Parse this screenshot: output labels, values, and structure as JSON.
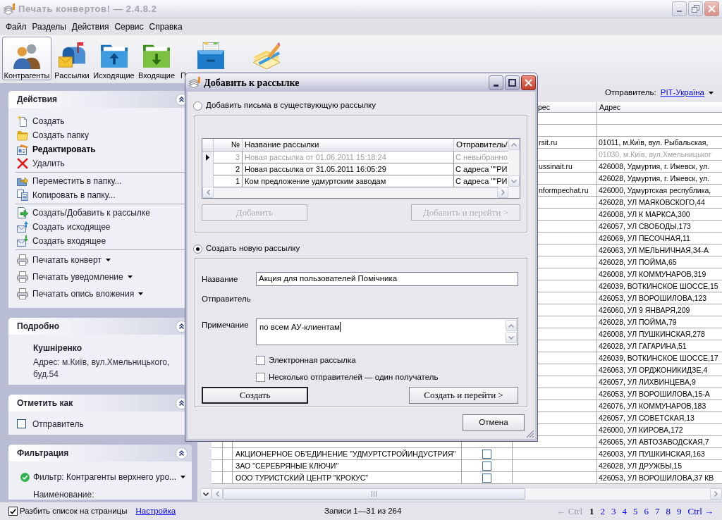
{
  "window": {
    "title": "Печать конвертов! — 2.4.8.2"
  },
  "menu": [
    "Файл",
    "Разделы",
    "Действия",
    "Сервис",
    "Справка"
  ],
  "toolbar": [
    {
      "label": "Контрагенты",
      "selected": true
    },
    {
      "label": "Рассылки",
      "selected": false
    },
    {
      "label": "Исходящие",
      "selected": false
    },
    {
      "label": "Входящие",
      "selected": false
    },
    {
      "label": "П",
      "selected": false
    },
    {
      "selected": false
    }
  ],
  "sidebar": {
    "actions": {
      "title": "Действия",
      "expanded": true,
      "groups": [
        [
          {
            "label": "Создать",
            "default": false,
            "dropdown": false
          },
          {
            "label": "Создать папку",
            "default": false,
            "dropdown": false
          },
          {
            "label": "Редактировать",
            "default": true,
            "dropdown": false
          },
          {
            "label": "Удалить",
            "default": false,
            "dropdown": false
          }
        ],
        [
          {
            "label": "Переместить в папку...",
            "default": false,
            "dropdown": false
          },
          {
            "label": "Копировать в папку...",
            "default": false,
            "dropdown": false
          }
        ],
        [
          {
            "label": "Создать/Добавить к рассылке",
            "default": false,
            "dropdown": false
          },
          {
            "label": "Создать исходящее",
            "default": false,
            "dropdown": false
          },
          {
            "label": "Создать входящее",
            "default": false,
            "dropdown": false
          }
        ],
        [
          {
            "label": "Печатать конверт",
            "default": false,
            "dropdown": true
          },
          {
            "label": "Печатать уведомление",
            "default": false,
            "dropdown": true
          },
          {
            "label": "Печатать опись вложения",
            "default": false,
            "dropdown": true
          }
        ]
      ]
    },
    "details": {
      "title": "Подробно",
      "expanded": true,
      "name": "Кушніренко",
      "address": "Адрес: м.Київ, вул.Хмельницького, буд.54"
    },
    "mark_as": {
      "title": "Отметить как",
      "expanded": true,
      "options": [
        {
          "label": "Отправитель",
          "checked": false
        }
      ]
    },
    "filtering": {
      "title": "Фильтрация",
      "expanded": true,
      "filter": "Фильтр: Контрагенты верхнего уро...",
      "field_label": "Наименование:"
    }
  },
  "list_header": {
    "sender_label": "Отправитель:",
    "sender": "РІТ-Україна"
  },
  "table": {
    "columns": [
      "рес",
      "Адрес"
    ],
    "rows": [
      {},
      {},
      {
        "email": "rsit.ru",
        "address": "01011, м.Київ, вул. Рыбальская,",
        "grayed": false
      },
      {
        "address": "01030, м.Київ, вул.Хмельницьког",
        "grayed": true
      },
      {
        "email": "ussinait.ru",
        "address": "426008, Удмуртия, г. Ижевск, ул.",
        "grayed": false
      },
      {
        "address": "426028, Удмуртия, г. Ижевск, ул.",
        "grayed": false
      },
      {
        "email": "nformpechat.ru",
        "address": "426000, Удмуртская республика,",
        "grayed": false
      },
      {
        "address": "426028, УЛ МАЯКОВСКОГО,44",
        "grayed": false
      },
      {
        "address": "426008, УЛ К МАРКСА,300",
        "grayed": false
      },
      {
        "address": "426057, УЛ СВОБОДЫ,173",
        "grayed": false
      },
      {
        "address": "426069, УЛ ПЕСОЧНАЯ,11",
        "grayed": false
      },
      {
        "address": "426063, УЛ МЕЛЬНИЧНАЯ,34-А",
        "grayed": false
      },
      {
        "address": "426028, УЛ ПОЙМА,65",
        "grayed": false
      },
      {
        "address": "426008, УЛ КОММУНАРОВ,319",
        "grayed": false
      },
      {
        "address": "426039, ВОТКИНСКОЕ ШОССЕ,15",
        "grayed": false
      },
      {
        "address": "426053, УЛ ВОРОШИЛОВА,123",
        "grayed": false
      },
      {
        "address": "426060, УЛ 9 ЯНВАРЯ,209",
        "grayed": false
      },
      {
        "address": "426028, УЛ ПОЙМА,79",
        "grayed": false
      },
      {
        "address": "426008, УЛ ПУШКИНСКАЯ,278",
        "grayed": false
      },
      {
        "address": "426028, УЛ ГАГАРИНА,51",
        "grayed": false
      },
      {
        "address": "426039, ВОТКИНСКОЕ ШОССЕ,17",
        "grayed": false
      },
      {
        "address": "426063, УЛ ОРДЖОНИКИДЗЕ,4",
        "grayed": false
      },
      {
        "address": "426057, УЛ ЛИХВИНЦЕВА,9",
        "grayed": false
      },
      {
        "address": "426053, УЛ ВОРОШИЛОВА,15-А",
        "grayed": false
      },
      {
        "address": "426076, УЛ КОММУНАРОВ,183",
        "grayed": false
      },
      {
        "address": "426057, УЛ СОВЕТСКАЯ,13",
        "grayed": false
      },
      {
        "address": "426000, УЛ КИРОВА,172",
        "grayed": false
      },
      {
        "address": "426065, УЛ АВТОЗАВОДСКАЯ,7",
        "grayed": false
      },
      {
        "name": "АКЦИОНЕРНОЕ ОБ'ЕДИНЕНИЕ \"УДМУРТСТРОЙИНДУСТРИЯ\"",
        "checked": false,
        "address": "426003, УЛ ПУШКИНСКАЯ,163",
        "grayed": false
      },
      {
        "name": "ЗАО \"СЕРЕБРЯНЫЕ КЛЮЧИ\"",
        "checked": false,
        "address": "426028, УЛ ДРУЖБЫ,15",
        "grayed": false
      },
      {
        "name": "ООО ТУРИСТСКИЙ ЦЕНТР \"КРОКУС\"",
        "checked": false,
        "address": "426053, УЛ ВОРОШИЛОВА,37 КВ",
        "grayed": false
      }
    ]
  },
  "dialog": {
    "title": "Добавить к рассылке",
    "existing": {
      "label": "Добавить письма в существующую рассылку",
      "selected": false,
      "columns": [
        "№",
        "Название рассылки",
        "Отправитель/"
      ],
      "rows": [
        {
          "number": "3",
          "name": "Новая рассылка от 01.06.2011 15:18:24",
          "sender": "С невыбранно",
          "selected": true,
          "grayed": true
        },
        {
          "number": "2",
          "name": "Новая рассылка от 31.05.2011 16:05:29",
          "sender": "С адреса \"\"РИ",
          "selected": false,
          "grayed": false
        },
        {
          "number": "1",
          "name": "Ком предложение удмуртским заводам",
          "sender": "С адреса \"\"РИ",
          "selected": false,
          "grayed": false
        }
      ],
      "buttons": [
        {
          "label": "Добавить",
          "disabled": true
        },
        {
          "label": "Добавить и перейти >",
          "disabled": true
        }
      ]
    },
    "create": {
      "label": "Создать новую рассылку",
      "selected": true,
      "name_field": {
        "label": "Название",
        "value": "Акция для пользователей Помічника"
      },
      "sender_label": "Отправитель",
      "note_field": {
        "label": "Примечание",
        "value": "по всем АУ-клиентам",
        "focused": true
      },
      "options": [
        {
          "label": "Электронная рассылка",
          "checked": false
        },
        {
          "label": "Несколько отправителей — один получатель",
          "checked": false
        }
      ],
      "buttons": [
        {
          "label": "Создать",
          "default": true
        },
        {
          "label": "Создать и перейти >",
          "default": false
        }
      ]
    },
    "cancel": "Отмена"
  },
  "status_bar": {
    "paginate": {
      "label": "Разбить список на страницы",
      "checked": true
    },
    "settings_link": "Настройка",
    "records": "Записи 1—31 из 264",
    "pager": {
      "prev": {
        "label": "← Ctrl",
        "disabled": true
      },
      "pages": [
        {
          "label": "1",
          "selected": true
        },
        {
          "label": "2",
          "selected": false
        },
        {
          "label": "3",
          "selected": false
        },
        {
          "label": "4",
          "selected": false
        },
        {
          "label": "5",
          "selected": false
        },
        {
          "label": "6",
          "selected": false
        },
        {
          "label": "7",
          "selected": false
        },
        {
          "label": "8",
          "selected": false
        },
        {
          "label": "9",
          "selected": false
        }
      ],
      "next": {
        "label": "Ctrl →",
        "disabled": false
      }
    }
  }
}
